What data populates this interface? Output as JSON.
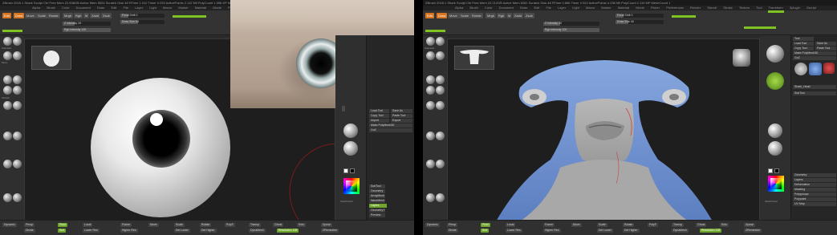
{
  "left_panel": {
    "window_title": "ZBrush 2018.1   Shark Sculpt Ctrl   Free Mem 22.838GB   Active Mem 5524   Scratch Disk 48   RTime 1.012   Timer 0.033   ActivePoints 2.112 Mil   PolyCount 1.056 KP   MeshCount 1",
    "menus": [
      "Alpha",
      "Brush",
      "Color",
      "Document",
      "Draw",
      "Edit",
      "File",
      "Layer",
      "Light",
      "Macro",
      "Marker",
      "Material",
      "Movie",
      "Picker",
      "Preferences",
      "Render",
      "Stencil",
      "Stroke",
      "Texture",
      "Tool",
      "Transform",
      "Zplugin",
      "Zscript"
    ],
    "toolbar": {
      "focal_shift": "Focal Shift 0",
      "draw_size": "Draw Size 64",
      "z_intensity": "Z Intensity 25",
      "rgb_intensity": "Rgb Intensity 100",
      "buttons": [
        "Edit",
        "Draw",
        "Move",
        "Scale",
        "Rotate",
        "Mrgb",
        "Rgb",
        "M",
        "Zadd",
        "Zsub"
      ],
      "active_buttons": [
        "Edit",
        "Draw"
      ]
    },
    "shelf_labels": [
      "Standard",
      "ClayBuildup",
      "Move",
      "DamStandard",
      "hPolish",
      "TrimDynamic",
      "Inflate",
      "Pinch",
      "SnakeHook",
      "Dots",
      "DragRect",
      "FreeHand"
    ],
    "right_tray_labels": [
      "SkinShade4",
      "MatCap Gray",
      "BasicMaterial",
      "Gradient",
      "SwitchColor",
      "Alternate"
    ],
    "tool_panel_rows": [
      "Load Tool",
      "Save As",
      "Copy Tool",
      "Paste Tool",
      "Import",
      "Export",
      "Clone",
      "Make PolyMesh3D",
      "GoZ",
      "All",
      "Visible",
      "R",
      "Lightbox > Tools",
      "SubTool",
      "Geometry",
      "ArrayMesh",
      "NanoMesh",
      "Layers",
      "FiberMesh",
      "Geometry HD",
      "Preview",
      "Surface",
      "Deformation",
      "Masking",
      "Visibility",
      "Polygroups",
      "Contact",
      "Morph Target",
      "Polypaint",
      "UV Map",
      "Texture Map",
      "Displacement Map",
      "Normal Map"
    ],
    "bottom_bar": {
      "buttons": [
        "Dynamic",
        "Persp",
        "Floor",
        "Local",
        "Frame",
        "Move",
        "Scale",
        "Rotate",
        "PolyF",
        "Transp",
        "Ghost",
        "Solo",
        "Xpose"
      ],
      "sliders": [
        "Divide",
        "Smt",
        "Lower Res",
        "Higher Res",
        "Del Lower",
        "Del Higher",
        "DynaMesh",
        "Resolution 128",
        "ZRemesher"
      ]
    }
  },
  "right_panel": {
    "window_title": "ZBrush 2018.1   Shark Sculpt Ctrl   Free Mem 22.212GB   Active Mem 6281   Scratch Disk 48   RTime 0.886   Timer 0.022   ActivePoints 4.238 Mil   PolyCount 2.119 MP   MeshCount 1",
    "menus": [
      "Alpha",
      "Brush",
      "Color",
      "Document",
      "Draw",
      "Edit",
      "File",
      "Layer",
      "Light",
      "Macro",
      "Marker",
      "Material",
      "Movie",
      "Picker",
      "Preferences",
      "Render",
      "Stencil",
      "Stroke",
      "Texture",
      "Tool",
      "Transform",
      "Zplugin",
      "Zscript"
    ],
    "toolbar": {
      "focal_shift": "Focal Shift 0",
      "draw_size": "Draw Size 40",
      "z_intensity": "Z Intensity 30",
      "rgb_intensity": "Rgb Intensity 100",
      "buttons": [
        "Edit",
        "Draw",
        "Move",
        "Scale",
        "Rotate",
        "Mrgb",
        "Rgb",
        "M",
        "Zadd",
        "Zsub"
      ],
      "active_buttons": [
        "Edit",
        "Draw"
      ]
    },
    "shelf_labels": [
      "Standard",
      "ClayBuildup",
      "Move",
      "DamStandard",
      "hPolish",
      "TrimDynamic",
      "Inflate",
      "Pinch",
      "SnakeHook",
      "Dots",
      "DragRect",
      "FreeHand"
    ],
    "right_tray_labels": [
      "SkinShade4",
      "MatCap Gray",
      "BasicMaterial",
      "Gradient",
      "SwitchColor",
      "Alternate"
    ],
    "tool_panel_rows": [
      "Tool",
      "Load Tool",
      "Save As",
      "Copy Tool",
      "Paste Tool",
      "Import",
      "Export",
      "Clone",
      "Make PolyMesh3D",
      "GoZ",
      "All",
      "Visible",
      "Lightbox > Tools",
      "Shark_Head",
      "SubTool",
      "Geometry",
      "Layers",
      "Deformation",
      "Masking",
      "Polygroups",
      "Polypaint",
      "UV Map"
    ],
    "bottom_bar": {
      "buttons": [
        "Dynamic",
        "Persp",
        "Floor",
        "Local",
        "Frame",
        "Move",
        "Scale",
        "Rotate",
        "PolyF",
        "Transp",
        "Ghost",
        "Solo",
        "Xpose"
      ],
      "sliders": [
        "Divide",
        "Smt",
        "Lower Res",
        "Higher Res",
        "Del Lower",
        "Del Higher",
        "DynaMesh",
        "Resolution 128",
        "ZRemesher"
      ]
    }
  },
  "colors": {
    "accent_orange": "#d6741f",
    "active_green": "#7fc321",
    "shark_blue": "#6b8fcf",
    "ui_dark": "#2b2b2b"
  }
}
